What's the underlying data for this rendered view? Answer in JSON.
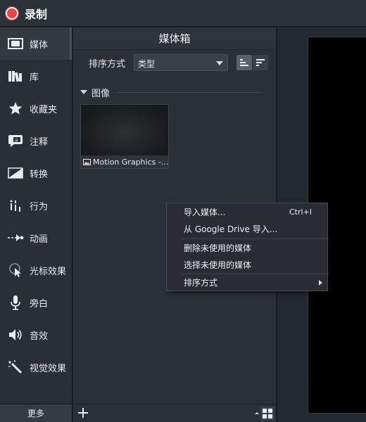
{
  "titlebar": {
    "record_label": "录制"
  },
  "sidebar": {
    "items": [
      {
        "label": "媒体",
        "icon": "film-icon"
      },
      {
        "label": "库",
        "icon": "library-icon"
      },
      {
        "label": "收藏夹",
        "icon": "star-icon"
      },
      {
        "label": "注释",
        "icon": "annotation-icon"
      },
      {
        "label": "转换",
        "icon": "transition-icon"
      },
      {
        "label": "行为",
        "icon": "behavior-icon"
      },
      {
        "label": "动画",
        "icon": "animation-icon"
      },
      {
        "label": "光标效果",
        "icon": "cursor-effect-icon"
      },
      {
        "label": "旁白",
        "icon": "microphone-icon"
      },
      {
        "label": "音效",
        "icon": "speaker-icon"
      },
      {
        "label": "视觉效果",
        "icon": "magic-wand-icon"
      }
    ],
    "active_index": 0,
    "more_label": "更多"
  },
  "media_bin": {
    "title": "媒体箱",
    "sort_label": "排序方式",
    "sort_value": "类型",
    "group_label": "图像",
    "items": [
      {
        "name": "Motion Graphics -...",
        "icon": "image-icon"
      }
    ]
  },
  "context_menu": {
    "items": [
      {
        "label": "导入媒体...",
        "shortcut": "Ctrl+I"
      },
      {
        "label": "从 Google Drive 导入..."
      },
      {
        "label": "删除未使用的媒体"
      },
      {
        "label": "选择未使用的媒体"
      },
      {
        "label": "排序方式",
        "submenu": true
      }
    ]
  },
  "colors": {
    "record_red": "#e8434b",
    "panel_bg": "#2b3037",
    "canvas_bg": "#000000"
  }
}
